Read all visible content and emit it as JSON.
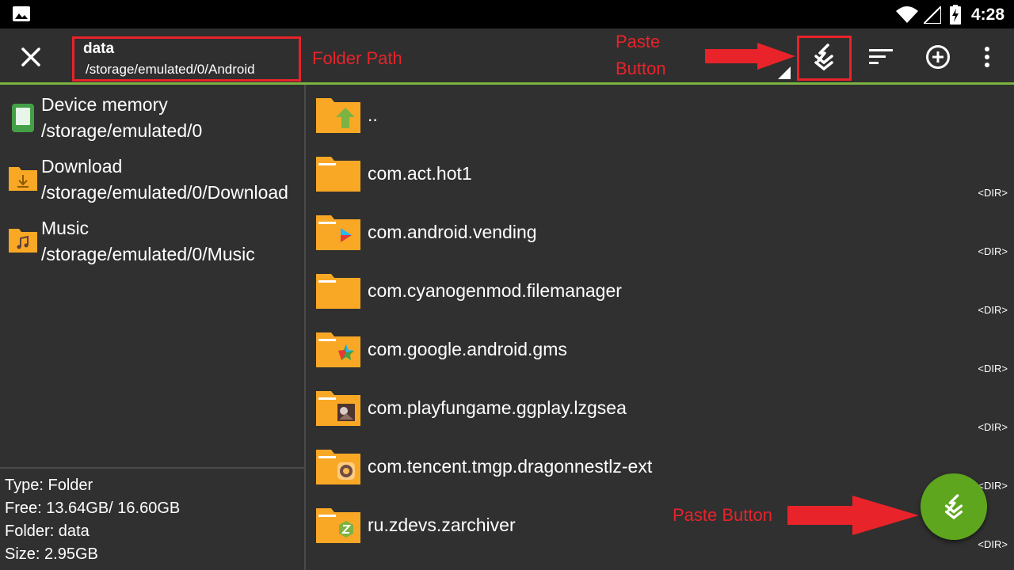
{
  "status_bar": {
    "time": "4:28",
    "icons": [
      "gallery-icon",
      "wifi-icon",
      "signal-icon",
      "battery-charging-icon"
    ]
  },
  "app_bar": {
    "folder_name": "data",
    "folder_path": "/storage/emulated/0/Android",
    "actions": [
      "paste-icon",
      "sort-icon",
      "add-circle-icon",
      "more-vert-icon"
    ]
  },
  "annotations": {
    "folder_path": "Folder Path",
    "paste_button_top_line1": "Paste",
    "paste_button_top_line2": "Button",
    "paste_button_fab": "Paste Button",
    "color": "#e8232a"
  },
  "bookmarks": [
    {
      "name": "Device memory",
      "path": "/storage/emulated/0",
      "icon": "device-memory-icon"
    },
    {
      "name": "Download",
      "path": "/storage/emulated/0/Download",
      "icon": "download-folder-icon"
    },
    {
      "name": "Music",
      "path": "/storage/emulated/0/Music",
      "icon": "music-folder-icon"
    }
  ],
  "info": {
    "type": "Type: Folder",
    "free": "Free: 13.64GB/ 16.60GB",
    "folder": "Folder: data",
    "size": "Size: 2.95GB"
  },
  "files": [
    {
      "name": "..",
      "tag": "",
      "icon": "parent-folder-icon"
    },
    {
      "name": "com.act.hot1",
      "tag": "<DIR>",
      "icon": "folder-icon"
    },
    {
      "name": "com.android.vending",
      "tag": "<DIR>",
      "icon": "play-store-folder-icon"
    },
    {
      "name": "com.cyanogenmod.filemanager",
      "tag": "<DIR>",
      "icon": "folder-icon"
    },
    {
      "name": "com.google.android.gms",
      "tag": "<DIR>",
      "icon": "play-services-folder-icon"
    },
    {
      "name": "com.playfungame.ggplay.lzgsea",
      "tag": "<DIR>",
      "icon": "game-folder-icon"
    },
    {
      "name": "com.tencent.tmgp.dragonnestlz-ext",
      "tag": "<DIR>",
      "icon": "game-folder-icon"
    },
    {
      "name": "ru.zdevs.zarchiver",
      "tag": "<DIR>",
      "icon": "zarchiver-folder-icon"
    }
  ],
  "colors": {
    "accent": "#7cb342",
    "fab": "#5ea61d",
    "folder": "#f9a825",
    "background": "#303030"
  }
}
